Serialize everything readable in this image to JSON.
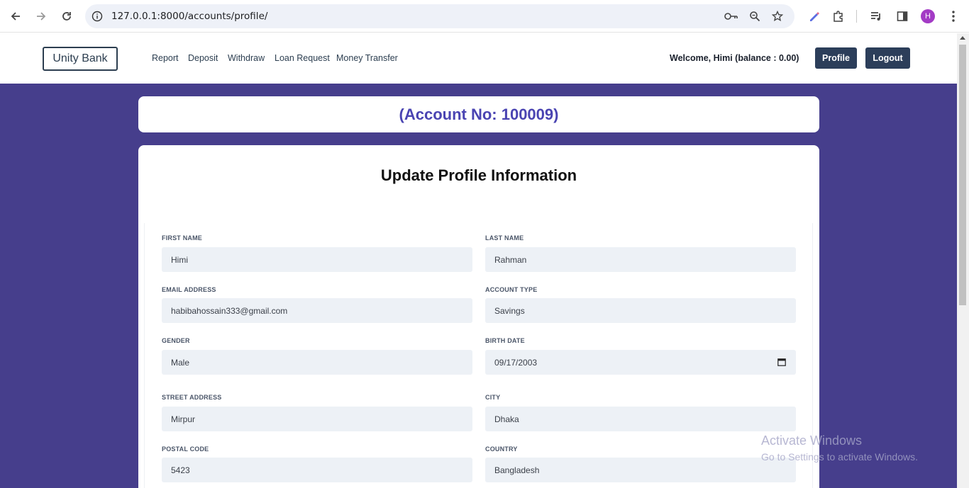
{
  "browser": {
    "url": "127.0.0.1:8000/accounts/profile/",
    "profile_initial": "H",
    "icons": [
      "back-icon",
      "forward-icon",
      "reload-icon",
      "site-info-icon",
      "password-key-icon",
      "zoom-icon",
      "bookmark-star-icon",
      "extension-pen-icon",
      "extensions-puzzle-icon",
      "media-queue-icon",
      "side-panel-icon",
      "menu-kebab-icon"
    ]
  },
  "header": {
    "brand": "Unity Bank",
    "nav": [
      "Report",
      "Deposit",
      "Withdraw",
      "Loan Request",
      "Money Transfer"
    ],
    "welcome": "Welcome, Himi (balance : 0.00)",
    "profile_button": "Profile",
    "logout_button": "Logout"
  },
  "account": {
    "heading": "(Account No: 100009)"
  },
  "form": {
    "title": "Update Profile Information",
    "fields": {
      "first_name": {
        "label": "FIRST NAME",
        "value": "Himi"
      },
      "last_name": {
        "label": "LAST NAME",
        "value": "Rahman"
      },
      "email": {
        "label": "EMAIL ADDRESS",
        "value": "habibahossain333@gmail.com"
      },
      "account_type": {
        "label": "ACCOUNT TYPE",
        "value": "Savings"
      },
      "gender": {
        "label": "GENDER",
        "value": "Male"
      },
      "birth_date": {
        "label": "BIRTH DATE",
        "value": "09/17/2003"
      },
      "street": {
        "label": "STREET ADDRESS",
        "value": "Mirpur"
      },
      "city": {
        "label": "CITY",
        "value": "Dhaka"
      },
      "postal_code": {
        "label": "POSTAL CODE",
        "value": "5423"
      },
      "country": {
        "label": "COUNTRY",
        "value": "Bangladesh"
      }
    }
  },
  "watermark": {
    "line1": "Activate Windows",
    "line2": "Go to Settings to activate Windows."
  },
  "colors": {
    "page_bg": "#463e8c",
    "accent_text": "#4a44b2",
    "button_bg": "#2c3e5a",
    "input_bg": "#edf1f6"
  }
}
